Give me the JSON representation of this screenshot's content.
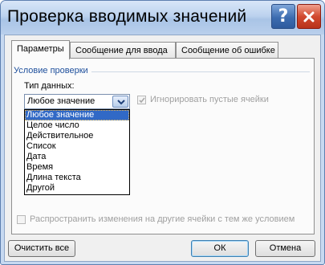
{
  "window": {
    "title": "Проверка вводимых значений"
  },
  "tabs": [
    {
      "label": "Параметры"
    },
    {
      "label": "Сообщение для ввода"
    },
    {
      "label": "Сообщение об ошибке"
    }
  ],
  "group": {
    "title": "Условие проверки"
  },
  "data_type": {
    "label": "Тип данных:",
    "value": "Любое значение",
    "options": [
      "Любое значение",
      "Целое число",
      "Действительное",
      "Список",
      "Дата",
      "Время",
      "Длина текста",
      "Другой"
    ]
  },
  "ignore_blank": {
    "label": "Игнорировать пустые ячейки",
    "checked": true,
    "enabled": false
  },
  "apply_all": {
    "label": "Распространить изменения на другие ячейки с тем же условием",
    "checked": false,
    "enabled": false
  },
  "buttons": {
    "clear_all": "Очистить все",
    "ok": "ОК",
    "cancel": "Отмена"
  },
  "colors": {
    "title_bar": "#bcd2ee",
    "selection": "#3169c6",
    "group_title": "#1e4f9c",
    "close_button": "#d24a2f"
  }
}
